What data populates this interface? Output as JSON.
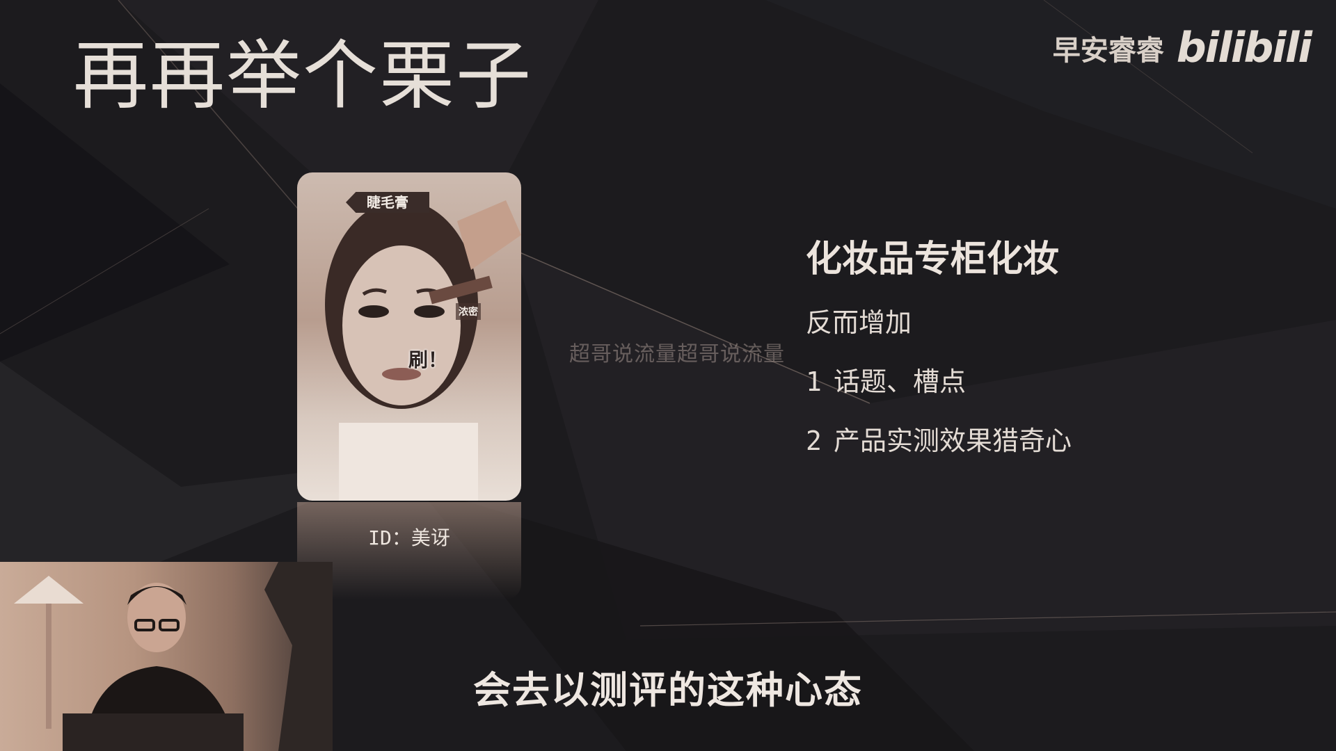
{
  "slide": {
    "title": "再再举个栗子"
  },
  "brand": {
    "name": "早安睿睿",
    "logo_text": "bilibili"
  },
  "card": {
    "tag": "睫毛膏",
    "small_label": "浓密",
    "brush_label": "刷！",
    "id_text": "ID：美讶"
  },
  "watermark": "超哥说流量超哥说流量",
  "bullets": {
    "heading": "化妆品专柜化妆",
    "line1": "反而增加",
    "item1_num": "1",
    "item1_text": "话题、槽点",
    "item2_num": "2",
    "item2_text": "产品实测效果猎奇心"
  },
  "subtitle": "会去以测评的这种心态",
  "colors": {
    "background": "#1c1b1e",
    "text": "#e9e2dc",
    "card_tone": "#b89d8f"
  }
}
